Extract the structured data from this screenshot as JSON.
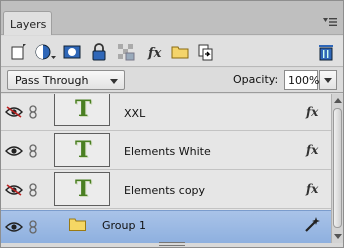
{
  "panel": {
    "tab_label": "Layers"
  },
  "toolbar": {
    "icons": [
      "new-layer-icon",
      "adjustment-layer-icon",
      "layer-mask-icon",
      "lock-all-icon",
      "lock-transparent-icon",
      "layer-style-fx-icon",
      "new-group-icon",
      "link-layers-icon",
      "delete-layer-icon"
    ]
  },
  "options": {
    "blend_mode": "Pass Through",
    "opacity_label": "Opacity:",
    "opacity_value": "100%"
  },
  "layers": [
    {
      "name": "XXL",
      "thumb_glyph": "T",
      "fx": "fx",
      "visible": false
    },
    {
      "name": "Elements White",
      "thumb_glyph": "T",
      "fx": "fx",
      "visible": true
    },
    {
      "name": "Elements copy",
      "thumb_glyph": "T",
      "fx": "fx",
      "visible": false
    },
    {
      "name": "Group 1",
      "type": "group",
      "visible": true,
      "selected": true
    }
  ],
  "colors": {
    "selection": "#9bb9e3",
    "text_thumb": "#4a7f22"
  }
}
